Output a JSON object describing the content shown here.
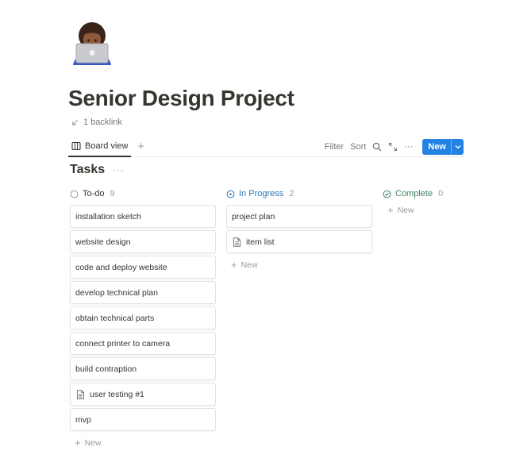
{
  "page": {
    "icon": "person-with-laptop-icon",
    "title": "Senior Design Project",
    "backlink": "1 backlink"
  },
  "viewbar": {
    "active_view": "Board view",
    "add_view": "+",
    "filter": "Filter",
    "sort": "Sort",
    "more": "···",
    "new_button": "New"
  },
  "database": {
    "title": "Tasks",
    "more": "···"
  },
  "colors": {
    "accent": "#2383e2",
    "todo": "#787774",
    "in_progress": "#2e75b6",
    "complete": "#448361"
  },
  "columns": [
    {
      "name": "To-do",
      "count": "9",
      "status_icon": "circle-icon",
      "cards": [
        {
          "title": "installation sketch",
          "icon": ""
        },
        {
          "title": "website design",
          "icon": ""
        },
        {
          "title": "code and deploy website",
          "icon": ""
        },
        {
          "title": "develop technical plan",
          "icon": ""
        },
        {
          "title": "obtain technical parts",
          "icon": ""
        },
        {
          "title": "connect printer to camera",
          "icon": ""
        },
        {
          "title": "build contraption",
          "icon": ""
        },
        {
          "title": "user testing #1",
          "icon": "document-icon"
        },
        {
          "title": "mvp",
          "icon": ""
        }
      ],
      "add_label": "New"
    },
    {
      "name": "In Progress",
      "count": "2",
      "status_icon": "play-circle-icon",
      "cards": [
        {
          "title": "project plan",
          "icon": ""
        },
        {
          "title": "item list",
          "icon": "document-icon"
        }
      ],
      "add_label": "New"
    },
    {
      "name": "Complete",
      "count": "0",
      "status_icon": "check-circle-icon",
      "cards": [],
      "add_label": "New"
    }
  ]
}
